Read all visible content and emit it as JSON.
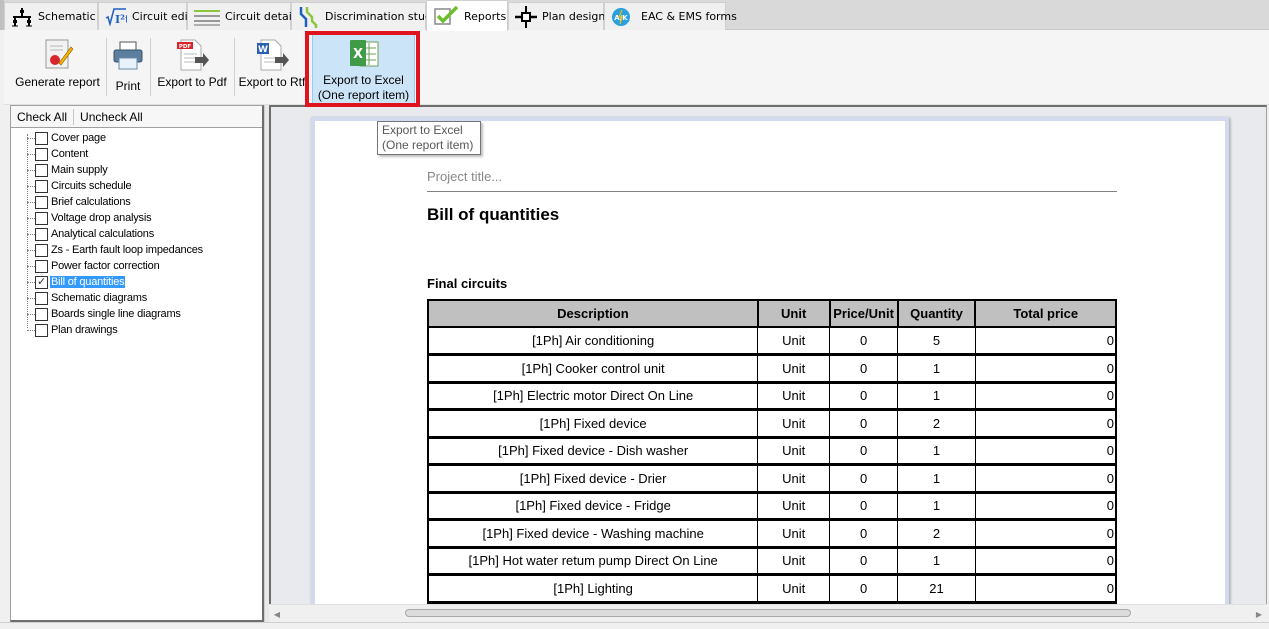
{
  "tabs": [
    {
      "label": "Schematic",
      "icon": "schematic-icon"
    },
    {
      "label": "Circuit edit",
      "icon": "circuit-edit-icon"
    },
    {
      "label": "Circuit details",
      "icon": "circuit-details-icon"
    },
    {
      "label": "Discrimination study",
      "icon": "discrimination-icon"
    },
    {
      "label": "Reports",
      "icon": "reports-icon",
      "active": true
    },
    {
      "label": "Plan design",
      "icon": "plan-design-icon"
    },
    {
      "label": "EAC & EMS forms",
      "icon": "eac-ems-icon"
    }
  ],
  "ribbon": {
    "generate_report": "Generate report",
    "print": "Print",
    "export_pdf": "Export to Pdf",
    "export_rtf": "Export to Rtf",
    "export_excel_line1": "Export to Excel",
    "export_excel_line2": "(One report item)"
  },
  "tooltip": {
    "line1": "Export to Excel",
    "line2": "(One report item)"
  },
  "left_panel": {
    "check_all": "Check All",
    "uncheck_all": "Uncheck All",
    "items": [
      {
        "label": "Cover page",
        "checked": false
      },
      {
        "label": "Content",
        "checked": false
      },
      {
        "label": "Main supply",
        "checked": false
      },
      {
        "label": "Circuits schedule",
        "checked": false
      },
      {
        "label": "Brief calculations",
        "checked": false
      },
      {
        "label": "Voltage drop analysis",
        "checked": false
      },
      {
        "label": "Analytical calculations",
        "checked": false
      },
      {
        "label": "Zs - Earth fault loop impedances",
        "checked": false
      },
      {
        "label": "Power factor correction",
        "checked": false
      },
      {
        "label": "Bill of quantities",
        "checked": true,
        "selected": true
      },
      {
        "label": "Schematic diagrams",
        "checked": false
      },
      {
        "label": "Boards single line diagrams",
        "checked": false
      },
      {
        "label": "Plan drawings",
        "checked": false
      }
    ]
  },
  "document": {
    "project_title": "Project title...",
    "title": "Bill of quantities",
    "section": "Final circuits",
    "columns": [
      "Description",
      "Unit",
      "Price/Unit",
      "Quantity",
      "Total price"
    ],
    "rows": [
      [
        "[1Ph] Air conditioning",
        "Unit",
        "0",
        "5",
        "0"
      ],
      [
        "[1Ph] Cooker control unit",
        "Unit",
        "0",
        "1",
        "0"
      ],
      [
        "[1Ph] Electric motor Direct On Line",
        "Unit",
        "0",
        "1",
        "0"
      ],
      [
        "[1Ph] Fixed device",
        "Unit",
        "0",
        "2",
        "0"
      ],
      [
        "[1Ph] Fixed device - Dish washer",
        "Unit",
        "0",
        "1",
        "0"
      ],
      [
        "[1Ph] Fixed device - Drier",
        "Unit",
        "0",
        "1",
        "0"
      ],
      [
        "[1Ph] Fixed device - Fridge",
        "Unit",
        "0",
        "1",
        "0"
      ],
      [
        "[1Ph] Fixed device - Washing machine",
        "Unit",
        "0",
        "2",
        "0"
      ],
      [
        "[1Ph] Hot water retum pump Direct On Line",
        "Unit",
        "0",
        "1",
        "0"
      ],
      [
        "[1Ph] Lighting",
        "Unit",
        "0",
        "21",
        "0"
      ]
    ]
  },
  "colors": {
    "highlight_box": "#e0141e",
    "selection": "#3399ff",
    "hover_button": "#cce4f7",
    "table_header": "#c0c0c0"
  }
}
